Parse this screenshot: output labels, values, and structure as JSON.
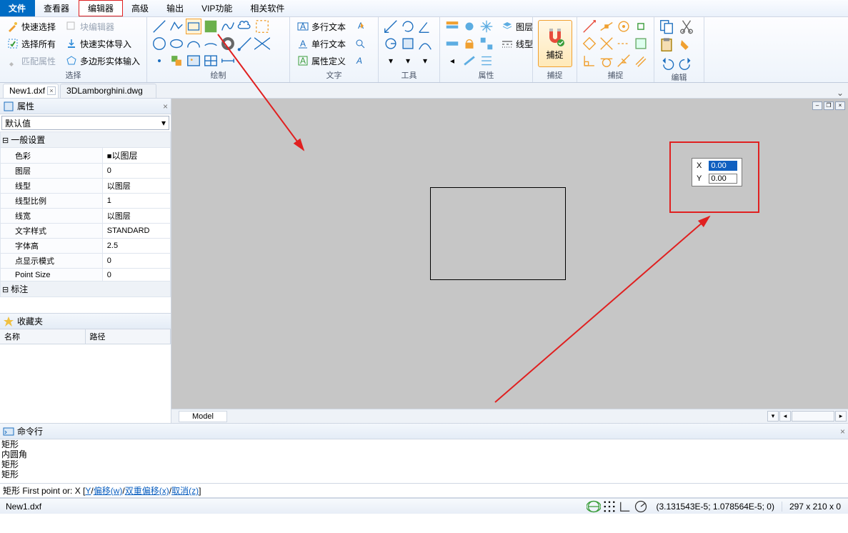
{
  "menu": {
    "file": "文件",
    "viewer": "查看器",
    "editor": "编辑器",
    "advanced": "高级",
    "output": "输出",
    "vip": "VIP功能",
    "related": "相关软件"
  },
  "ribbon": {
    "select": {
      "label": "选择",
      "quick": "快速选择",
      "blockedit": "块编辑器",
      "all": "选择所有",
      "entimport": "快速实体导入",
      "match": "匹配属性",
      "polyinput": "多边形实体输入"
    },
    "draw": {
      "label": "绘制"
    },
    "text": {
      "label": "文字",
      "mtext": "多行文本",
      "stext": "单行文本",
      "attdef": "属性定义"
    },
    "tools": {
      "label": "工具"
    },
    "attrs": {
      "label": "属性",
      "layer": "图层",
      "ltype": "线型"
    },
    "snap": {
      "label": "捕捉",
      "btn": "捕捉"
    },
    "edit": {
      "label": "编辑"
    }
  },
  "tabs": {
    "t1": "New1.dxf",
    "t2": "3DLamborghini.dwg"
  },
  "side": {
    "prop_title": "属性",
    "default": "默认值",
    "sect_general": "一般设置",
    "sect_dim": "标注",
    "rows": {
      "color_k": "色彩",
      "color_v": "以图层",
      "layer_k": "图层",
      "layer_v": "0",
      "ltype_k": "线型",
      "ltype_v": "以图层",
      "ltscale_k": "线型比例",
      "ltscale_v": "1",
      "lweight_k": "线宽",
      "lweight_v": "以图层",
      "tstyle_k": "文字样式",
      "tstyle_v": "STANDARD",
      "theight_k": "字体高",
      "theight_v": "2.5",
      "pdmode_k": "点显示模式",
      "pdmode_v": "0",
      "psize_k": "Point Size",
      "psize_v": "0"
    },
    "fav_title": "收藏夹",
    "fav_c1": "名称",
    "fav_c2": "路径"
  },
  "canvas": {
    "model": "Model",
    "coord_x_lbl": "X",
    "coord_x_val": "0.00",
    "coord_y_lbl": "Y",
    "coord_y_val": "0.00"
  },
  "cmd": {
    "title": "命令行",
    "hist": [
      "矩形",
      "内圆角",
      "矩形",
      "矩形"
    ],
    "prompt_pre": "矩形   First point or:   X   [   ",
    "y": "Y",
    "slash": "   /   ",
    "off": "偏移(w)",
    "doff": "双重偏移(x)",
    "cancel": "取消(z)",
    "end": "   ]"
  },
  "status": {
    "file": "New1.dxf",
    "coords": "(3.131543E-5; 1.078564E-5; 0)",
    "size": "297 x 210 x 0"
  }
}
